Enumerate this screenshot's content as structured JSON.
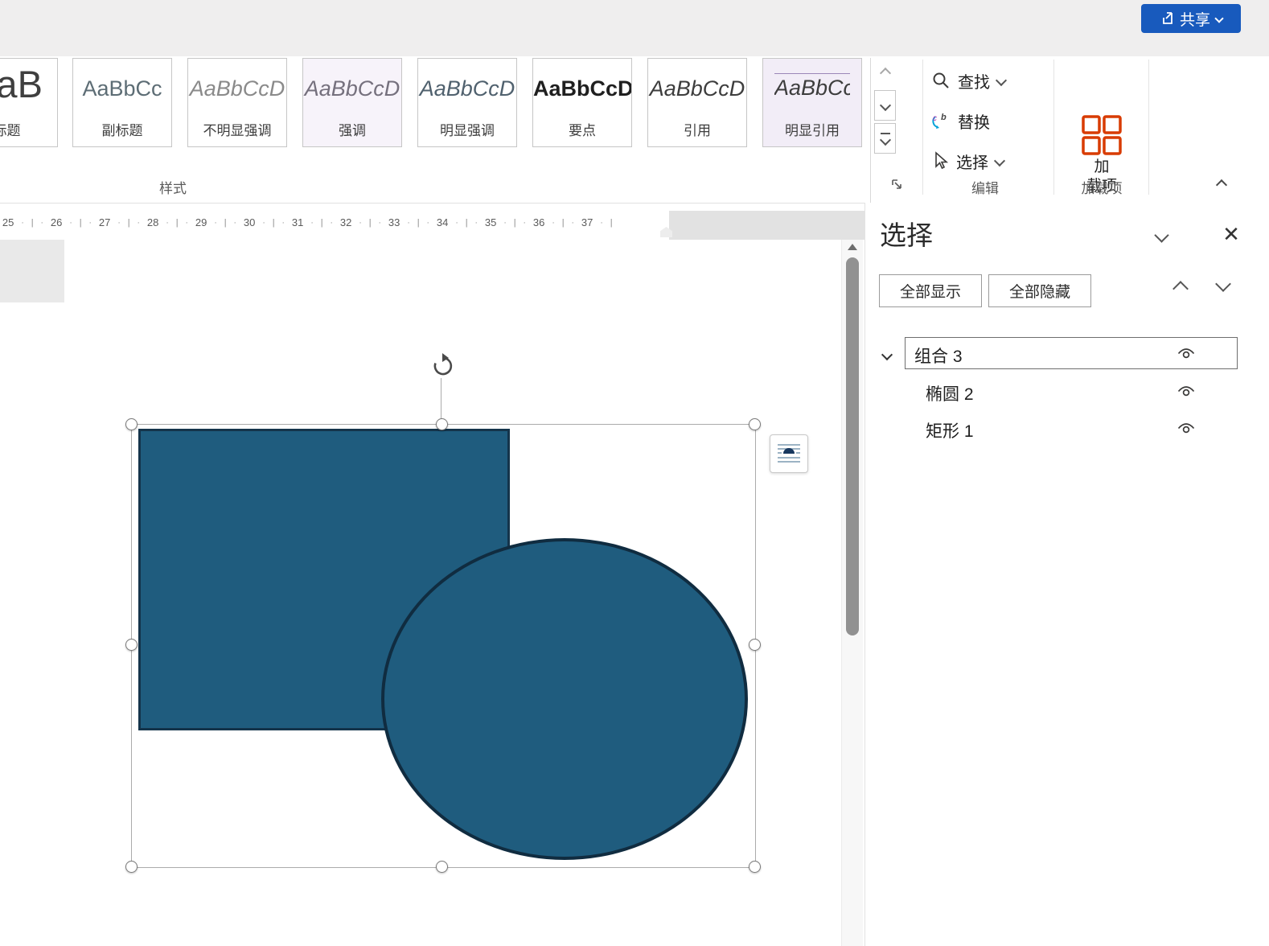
{
  "titlebar": {
    "share_label": "共享"
  },
  "ribbon": {
    "styles": {
      "group_label": "样式",
      "items": [
        {
          "preview": "AaB",
          "label": "标题"
        },
        {
          "preview": "AaBbCc",
          "label": "副标题"
        },
        {
          "preview": "AaBbCcD",
          "label": "不明显强调"
        },
        {
          "preview": "AaBbCcD",
          "label": "强调"
        },
        {
          "preview": "AaBbCcD",
          "label": "明显强调"
        },
        {
          "preview": "AaBbCcD",
          "label": "要点"
        },
        {
          "preview": "AaBbCcD",
          "label": "引用"
        },
        {
          "preview": "AaBbCcD",
          "label": "明显引用"
        }
      ]
    },
    "editing": {
      "group_label": "编辑",
      "find_label": "查找",
      "replace_label": "替换",
      "select_label": "选择"
    },
    "addins": {
      "group_label": "加载项",
      "button_line1": "加",
      "button_line2": "载项"
    }
  },
  "ruler": {
    "numbers": [
      "25",
      "26",
      "27",
      "28",
      "29",
      "30",
      "31",
      "32",
      "33",
      "34",
      "35",
      "36",
      "37"
    ]
  },
  "selection_pane": {
    "title": "选择",
    "show_all_label": "全部显示",
    "hide_all_label": "全部隐藏",
    "items": [
      {
        "label": "组合 3",
        "level": 0,
        "selected": true
      },
      {
        "label": "椭圆 2",
        "level": 1,
        "selected": false
      },
      {
        "label": "矩形 1",
        "level": 1,
        "selected": false
      }
    ]
  },
  "colors": {
    "shape_fill": "#1f5c7e",
    "shape_stroke": "#102c40",
    "share_button": "#185abd",
    "addins_icon": "#d83b01"
  }
}
